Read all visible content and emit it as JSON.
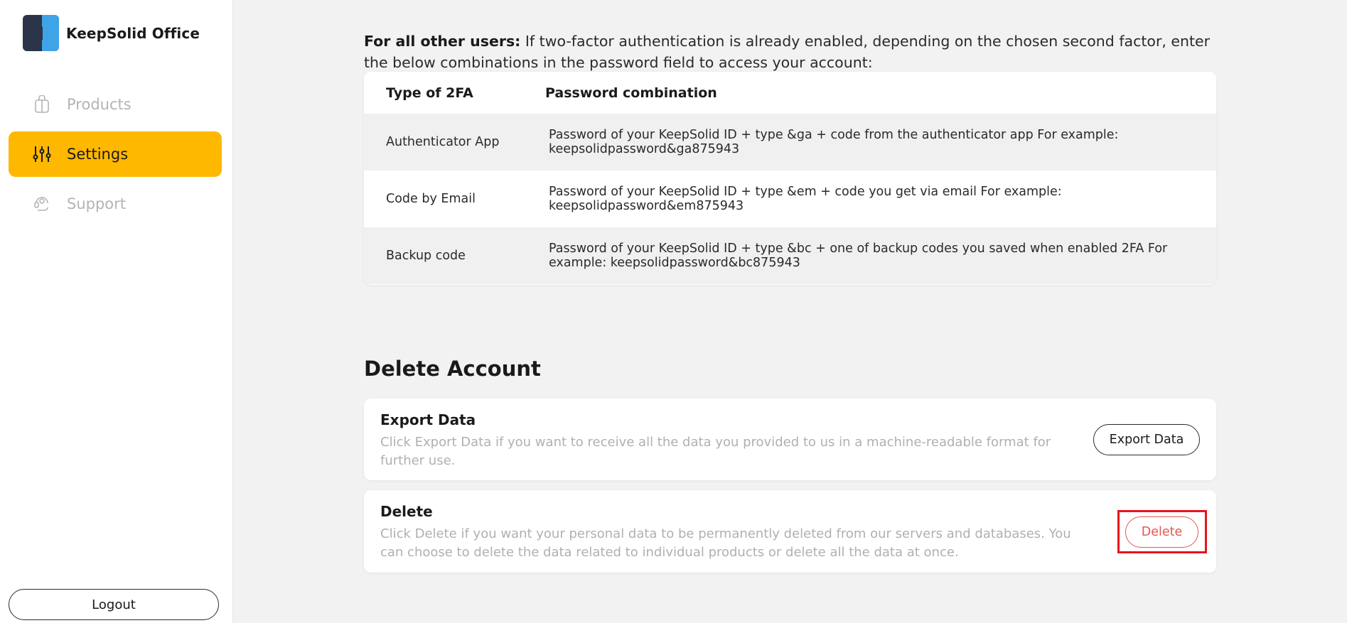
{
  "app": {
    "brand_name": "KeepSolid Office"
  },
  "sidebar": {
    "items": [
      {
        "label": "Products",
        "icon": "bag-icon",
        "active": false
      },
      {
        "label": "Settings",
        "icon": "sliders-icon",
        "active": true
      },
      {
        "label": "Support",
        "icon": "headset-icon",
        "active": false
      }
    ],
    "logout_label": "Logout"
  },
  "main": {
    "intro_bold": "For all other users:",
    "intro_text": " If two-factor authentication is already enabled, depending on the chosen second factor, enter the below combinations in the password field to access your account:",
    "table": {
      "headers": [
        "Type of 2FA",
        "Password combination"
      ],
      "rows": [
        {
          "type": "Authenticator App",
          "combination": "Password of your KeepSolid ID + type &ga + code from the authenticator app For example: keepsolidpassword&ga875943"
        },
        {
          "type": "Code by Email",
          "combination": "Password of your KeepSolid ID + type &em + code you get via email For example: keepsolidpassword&em875943"
        },
        {
          "type": "Backup code",
          "combination": "Password of your KeepSolid ID + type &bc + one of backup codes you saved when enabled 2FA For example: keepsolidpassword&bc875943"
        }
      ]
    },
    "delete_section": {
      "title": "Delete Account",
      "export": {
        "title": "Export Data",
        "description": "Click Export Data if you want to receive all the data you provided to us in a machine-readable format for further use.",
        "button_label": "Export Data"
      },
      "delete": {
        "title": "Delete",
        "description": "Click Delete if you want your personal data to be permanently deleted from our servers and databases. You can choose to delete the data related to individual products or delete all the data at once.",
        "button_label": "Delete"
      }
    }
  },
  "colors": {
    "accent": "#ffb800",
    "danger": "#e5574e",
    "highlight": "#e8141c"
  }
}
